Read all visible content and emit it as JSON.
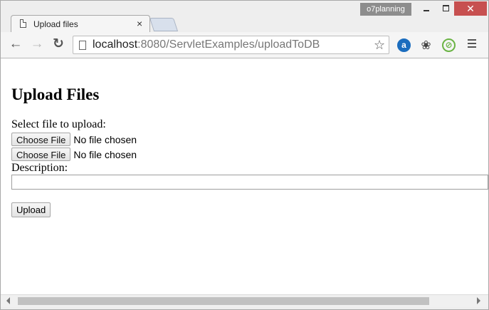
{
  "window": {
    "profile": "o7planning",
    "controls": {
      "close_glyph": "✕"
    }
  },
  "tab": {
    "title": "Upload files",
    "close_glyph": "×"
  },
  "toolbar": {
    "url_host": "localhost",
    "url_rest": ":8080/ServletExamples/uploadToDB",
    "icons": [
      "back-icon",
      "forward-icon",
      "reload-icon",
      "page-icon",
      "star-icon",
      "extension-a-icon",
      "bug-extension-icon",
      "circle-extension-icon",
      "menu-icon"
    ]
  },
  "page": {
    "heading": "Upload Files",
    "select_label": "Select file to upload:",
    "file_inputs": [
      {
        "button": "Choose File",
        "status": "No file chosen"
      },
      {
        "button": "Choose File",
        "status": "No file chosen"
      }
    ],
    "description_label": "Description:",
    "description_value": "",
    "upload_button": "Upload"
  },
  "colors": {
    "close_button": "#c75050",
    "profile_badge": "#8d8d8d",
    "circle_extension": "#6ab344",
    "a_extension": "#1b6dbe"
  }
}
